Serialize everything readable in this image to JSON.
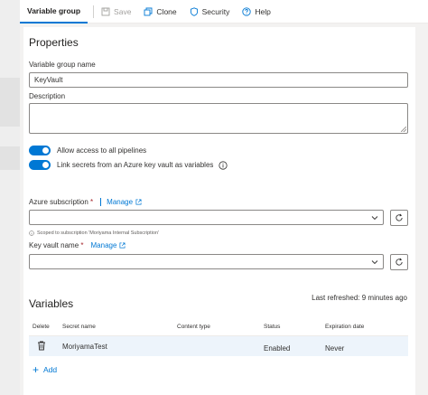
{
  "toolbar": {
    "tab": "Variable group",
    "save": "Save",
    "clone": "Clone",
    "security": "Security",
    "help": "Help"
  },
  "properties": {
    "heading": "Properties",
    "name_label": "Variable group name",
    "name_value": "KeyVault",
    "description_label": "Description",
    "description_value": "",
    "allow_access_label": "Allow access to all pipelines",
    "allow_access_on": true,
    "link_secrets_label": "Link secrets from an Azure key vault as variables",
    "link_secrets_on": true
  },
  "azure": {
    "subscription_label": "Azure subscription",
    "required_mark": "*",
    "manage_label": "Manage",
    "subscription_value": "",
    "scope_note": "Scoped to subscription 'Moriyama Internal Subscription'",
    "keyvault_label": "Key vault name",
    "keyvault_manage_label": "Manage",
    "keyvault_value": ""
  },
  "variables": {
    "heading": "Variables",
    "last_refreshed": "Last refreshed: 9 minutes ago",
    "columns": [
      "Delete",
      "Secret name",
      "Content type",
      "Status",
      "Expiration date"
    ],
    "rows": [
      {
        "secret_name": "MoriyamaTest",
        "content_type": "",
        "status": "Enabled",
        "expiration": "Never"
      }
    ],
    "add_label": "Add"
  },
  "colors": {
    "accent": "#0078d4",
    "row_highlight": "#edf4fb"
  }
}
